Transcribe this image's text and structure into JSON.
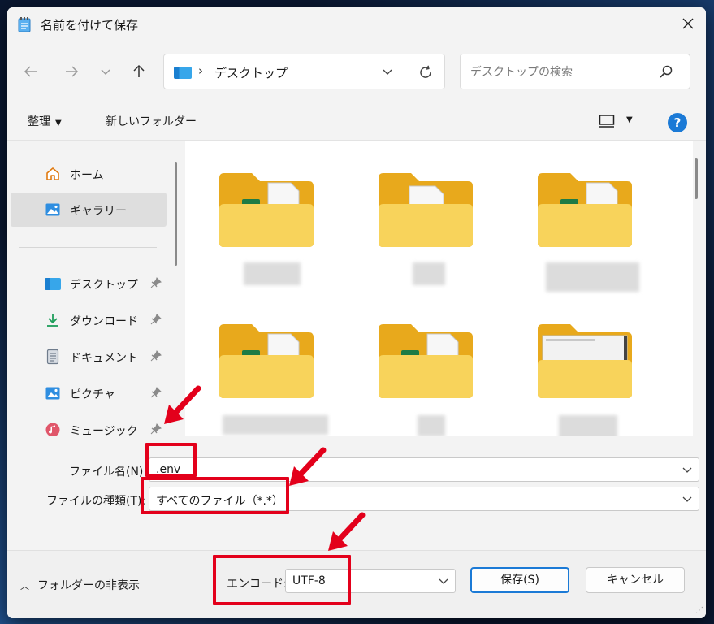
{
  "window": {
    "title": "名前を付けて保存",
    "close_glyph": "✕"
  },
  "nav": {
    "back": "←",
    "forward": "→",
    "history": "⌄",
    "up": "↑",
    "address_separator": "›",
    "address_path": "デスクトップ",
    "search_placeholder": "デスクトップの検索"
  },
  "toolbar": {
    "organize": "整理",
    "organize_caret": "▼",
    "new_folder": "新しいフォルダー",
    "view_caret": "▼",
    "help": "?"
  },
  "sidebar": {
    "items": [
      {
        "label": "ホーム",
        "icon": "home-icon",
        "pinned": false
      },
      {
        "label": "ギャラリー",
        "icon": "gallery-icon",
        "pinned": false,
        "selected": true
      },
      {
        "label": "デスクトップ",
        "icon": "desktop-icon",
        "pinned": true
      },
      {
        "label": "ダウンロード",
        "icon": "download-icon",
        "pinned": true
      },
      {
        "label": "ドキュメント",
        "icon": "document-icon",
        "pinned": true
      },
      {
        "label": "ピクチャ",
        "icon": "pictures-icon",
        "pinned": true
      },
      {
        "label": "ミュージック",
        "icon": "music-icon",
        "pinned": true
      }
    ]
  },
  "files": {
    "items": [
      {
        "icon": "excel-folder-icon"
      },
      {
        "icon": "document-folder-icon"
      },
      {
        "icon": "excel-folder-icon"
      },
      {
        "icon": "excel-folder-icon"
      },
      {
        "icon": "excel-folder-icon"
      },
      {
        "icon": "screenshot-folder-icon"
      }
    ]
  },
  "form": {
    "filename_label": "ファイル名(N):",
    "filename_value": ".env",
    "filetype_label": "ファイルの種類(T):",
    "filetype_value": "すべてのファイル（*.*）",
    "encode_label": "エンコード:",
    "encode_value": "UTF-8",
    "hide_folders": "フォルダーの非表示",
    "hide_folders_chevron": "︿",
    "save_button": "保存(S)",
    "cancel_button": "キャンセル"
  },
  "colors": {
    "highlight": "#e3001b",
    "accent": "#1b7ad6",
    "folder": "#f5c542"
  }
}
